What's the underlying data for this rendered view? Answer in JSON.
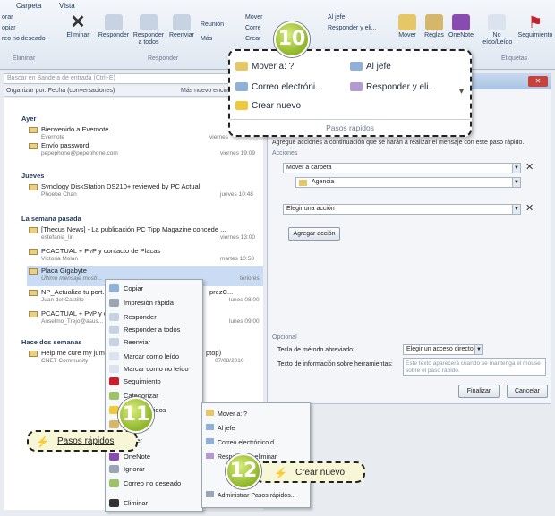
{
  "ribbon": {
    "tabs": [
      "Carpeta",
      "Vista"
    ],
    "left_labels": [
      "orar",
      "opiar",
      "reo no deseado"
    ],
    "buttons": {
      "eliminar": "Eliminar",
      "responder": "Responder",
      "responder_todos": "Responder a todos",
      "reenviar": "Reenviar",
      "reunion": "Reunión",
      "mas": "Más",
      "mover": "Mover",
      "reglas": "Reglas",
      "onenote": "OneNote",
      "no_leido": "No leído/Leído",
      "seguimiento": "Seguimiento"
    },
    "quicksteps_small": [
      "Mover",
      "Corre",
      "Crear",
      "Al jefe",
      "Responder y eli..."
    ],
    "groups": [
      "Eliminar",
      "Responder",
      "Etiquetas"
    ]
  },
  "search_placeholder": "Buscar en Bandeja de entrada (Ctrl+E)",
  "sortbar": {
    "left": "Organizar por: Fecha (conversaciones)",
    "right": "Más nuevo encima"
  },
  "groups": [
    "Ayer",
    "Jueves",
    "La semana pasada",
    "Hace dos semanas"
  ],
  "messages": [
    {
      "subject": "Bienvenido a Evernote",
      "from": "Evernote",
      "date": "viernes"
    },
    {
      "subject": "Envío password",
      "from": "pepephone@pepephone.com",
      "date": "viernes 19:09"
    },
    {
      "subject": "Synology DiskStation DS210+ reviewed by PC Actual",
      "from": "Phoebe Chan",
      "date": "jueves 10:48"
    },
    {
      "subject": "[Thecus News] - La publicación PC Tipp Magazine concede ...",
      "from": "estefania_lin",
      "date": "viernes 13:00"
    },
    {
      "subject": "PCACTUAL + PvP y contacto de Placas",
      "from": "Victoria Molan",
      "date": "martes 10:58"
    },
    {
      "subject": "Placa Gigabyte",
      "from": "Último mensaje mostr...",
      "date": "teriores"
    },
    {
      "subject": "NP_Actualiza tu port...",
      "from": "Juan del Castillo",
      "date": "lunes 08:00"
    },
    {
      "subject": "PCACTUAL + PvP y co...",
      "from": "Anselmo_Trejo@asus...",
      "date": "lunes 09:00"
    },
    {
      "subject": "Help me cure my jum...",
      "from": "CNET Community",
      "date": "07/08/2010"
    }
  ],
  "msg_fragments": [
    "prezC...",
    "ptop)"
  ],
  "quicksteps_popup": {
    "items": [
      "Mover a: ?",
      "Al jefe",
      "Correo electróni...",
      "Responder y eli...",
      "Crear nuevo"
    ],
    "title": "Pasos rápidos"
  },
  "right_panel": {
    "description": "Agregue acciones a continuación que se harán a realizar el mensaje con este paso rápido.",
    "section_acciones": "Acciones",
    "action1": "Mover a carpeta",
    "folder": "Agencia",
    "action2": "Elegir una acción",
    "add_action": "Agregar acción",
    "section_opcional": "Opcional",
    "shortcut_label": "Tecla de método abreviado:",
    "shortcut_value": "Elegir un acceso directo",
    "tooltip_label": "Texto de información sobre herramientas:",
    "tooltip_text": "Este texto aparecerá cuando se mantenga el mouse sobre el paso rápido.",
    "finish": "Finalizar",
    "cancel": "Cancelar"
  },
  "context_menu": [
    "Copiar",
    "Impresión rápida",
    "Responder",
    "Responder a todos",
    "Reenviar",
    "Marcar como leído",
    "Marcar como no leído",
    "Seguimiento",
    "Categorizar",
    "Pasos rápidos",
    "Reglas",
    "Mover",
    "OneNote",
    "Ignorar",
    "Correo no deseado",
    "Eliminar"
  ],
  "submenu": [
    "Mover a: ?",
    "Al jefe",
    "Correo electrónico d...",
    "Responder y eliminar",
    "Crear nuevo",
    "Administrar Pasos rápidos..."
  ],
  "callouts": {
    "b10": "10",
    "b11": "11",
    "b12": "12",
    "pasos_rapidos": "Pasos rápidos",
    "crear_nuevo": "Crear nuevo"
  },
  "colors": {
    "accent": "#1e395b",
    "badge": "#8fb52b",
    "callout_bg": "#f7f6d6",
    "selection": "#c9dcf3"
  }
}
